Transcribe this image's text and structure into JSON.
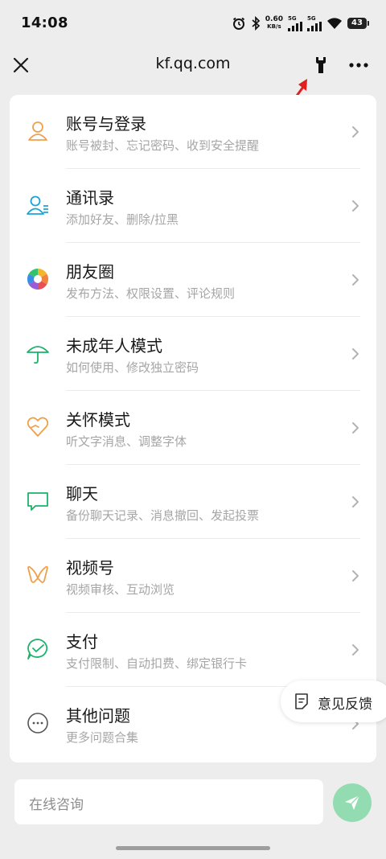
{
  "status_bar": {
    "time": "14:08",
    "net_speed_value": "0.60",
    "net_speed_unit": "KB/s",
    "sim1_label": "5G",
    "sim2_label": "5G",
    "battery_level": "43",
    "icons": [
      "alarm-icon",
      "bluetooth-icon",
      "signal-icon",
      "wifi-icon",
      "battery-icon"
    ]
  },
  "title_bar": {
    "title": "kf.qq.com",
    "icons": [
      "close-icon",
      "wrench-icon",
      "more-icon"
    ]
  },
  "annotation": {
    "arrow_color": "#e0201f"
  },
  "menu": {
    "items": [
      {
        "title": "账号与登录",
        "subtitle": "账号被封、忘记密码、收到安全提醒",
        "icon": "user-icon",
        "color": "#f0a04b"
      },
      {
        "title": "通讯录",
        "subtitle": "添加好友、删除/拉黑",
        "icon": "contacts-icon",
        "color": "#1aa3d9"
      },
      {
        "title": "朋友圈",
        "subtitle": "发布方法、权限设置、评论规则",
        "icon": "moments-icon",
        "color": "#f3b62b"
      },
      {
        "title": "未成年人模式",
        "subtitle": "如何使用、修改独立密码",
        "icon": "umbrella-icon",
        "color": "#1bb26a"
      },
      {
        "title": "关怀模式",
        "subtitle": "听文字消息、调整字体",
        "icon": "care-icon",
        "color": "#f0a04b"
      },
      {
        "title": "聊天",
        "subtitle": "备份聊天记录、消息撤回、发起投票",
        "icon": "chat-icon",
        "color": "#1bb26a"
      },
      {
        "title": "视频号",
        "subtitle": "视频审核、互动浏览",
        "icon": "channels-icon",
        "color": "#f0a04b"
      },
      {
        "title": "支付",
        "subtitle": "支付限制、自动扣费、绑定银行卡",
        "icon": "pay-icon",
        "color": "#1bb26a"
      },
      {
        "title": "其他问题",
        "subtitle": "更多问题合集",
        "icon": "more-circle-icon",
        "color": "#555555"
      }
    ]
  },
  "feedback": {
    "label": "意见反馈",
    "icon": "feedback-icon"
  },
  "input": {
    "placeholder": "在线咨询",
    "send_icon": "send-icon",
    "send_color": "#93dbb1"
  }
}
